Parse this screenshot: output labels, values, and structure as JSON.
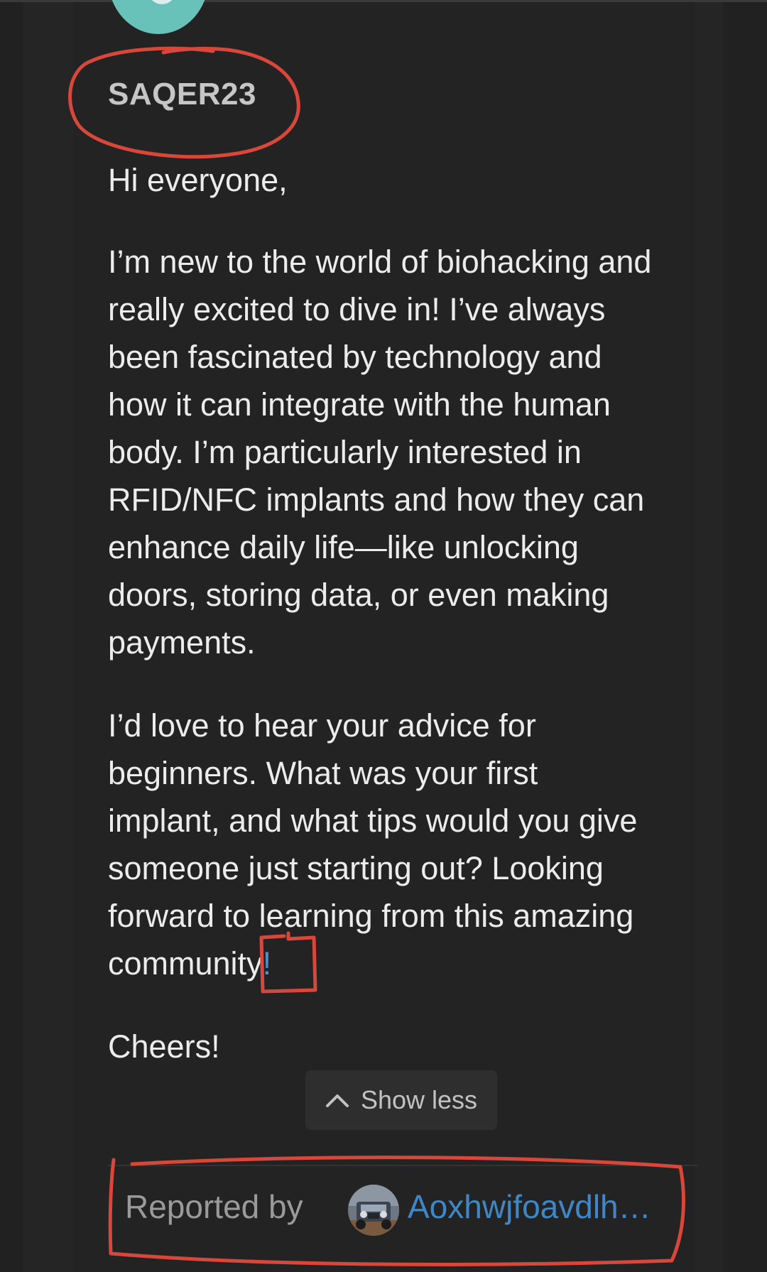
{
  "post": {
    "author": "SAQER23",
    "greeting": "Hi everyone,",
    "intro_lines": [
      "I’m new to the world of biohacking and",
      "really excited to dive in! I’ve always",
      "been fascinated by technology and",
      "how it can integrate with the human",
      "body. I’m particularly interested in",
      "RFID/NFC implants and how they can",
      "enhance daily life—like unlocking",
      "doors, storing data, or even making",
      "payments."
    ],
    "question_lines": [
      "I’d love to hear your advice for",
      "beginners. What was your first",
      "implant, and what tips would you give",
      "someone just starting out? Looking",
      "forward to learning from this amazing"
    ],
    "question_last_text": "community",
    "question_last_punct": "!",
    "signoff": "Cheers!"
  },
  "controls": {
    "show_less_label": "Show less",
    "show_less_icon": "chevron-up-icon"
  },
  "report": {
    "label": "Reported by",
    "reporter_name": "Aoxhwjfoavdlh…",
    "reporter_avatar_icon": "jeep-photo-avatar"
  },
  "colors": {
    "background": "#252525",
    "text": "#ececec",
    "muted": "#9a9a9a",
    "link": "#3f87c6",
    "avatar_teal": "#69c2b9",
    "annotation_red": "#d9473a"
  }
}
